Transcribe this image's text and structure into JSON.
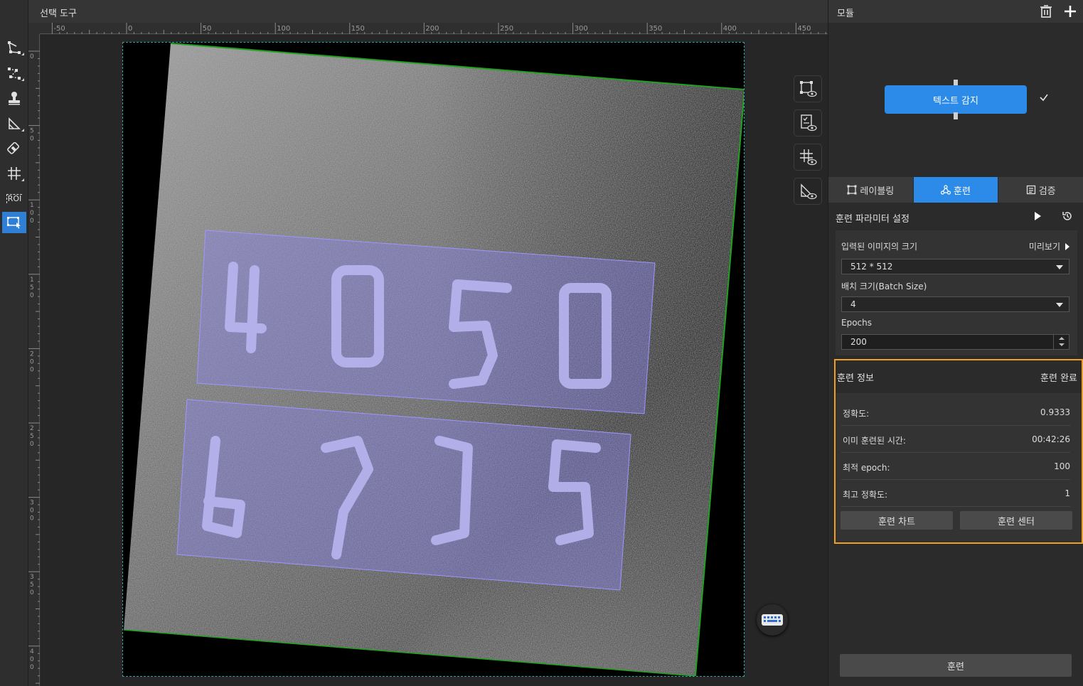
{
  "canvas": {
    "title": "선택 도구",
    "ruler_top_labels": [
      "-50",
      "0",
      "50",
      "100",
      "150",
      "200",
      "250",
      "300",
      "350",
      "400",
      "450"
    ],
    "ruler_left_labels": [
      "0",
      "50",
      "100",
      "150",
      "200",
      "250",
      "300",
      "350",
      "400"
    ],
    "roi_label": "ROI"
  },
  "module": {
    "title": "모듈",
    "node_label": "텍스트 감지"
  },
  "tabs": [
    {
      "label": "레이블링",
      "icon": "labeling-icon"
    },
    {
      "label": "훈련",
      "icon": "train-icon"
    },
    {
      "label": "검증",
      "icon": "validate-icon"
    }
  ],
  "params": {
    "title": "훈련 파라미터 설정",
    "input_size_label": "입력된 이미지의 크기",
    "preview_label": "미리보기",
    "input_size_value": "512 * 512",
    "batch_label": "배치 크기(Batch Size)",
    "batch_value": "4",
    "epochs_label": "Epochs",
    "epochs_value": "200"
  },
  "train_info": {
    "title": "훈련 정보",
    "status": "훈련 완료",
    "rows": [
      {
        "key": "정확도:",
        "value": "0.9333"
      },
      {
        "key": "이미 훈련된 시간:",
        "value": "00:42:26"
      },
      {
        "key": "최적 epoch:",
        "value": "100"
      },
      {
        "key": "최고 정확도:",
        "value": "1"
      }
    ],
    "chart_button": "훈련 차트",
    "center_button": "훈련 센터"
  },
  "train_button": "훈련",
  "colors": {
    "accent": "#2c8ae8",
    "highlight": "#f0a020",
    "roi_fill": "#8a84f0"
  }
}
